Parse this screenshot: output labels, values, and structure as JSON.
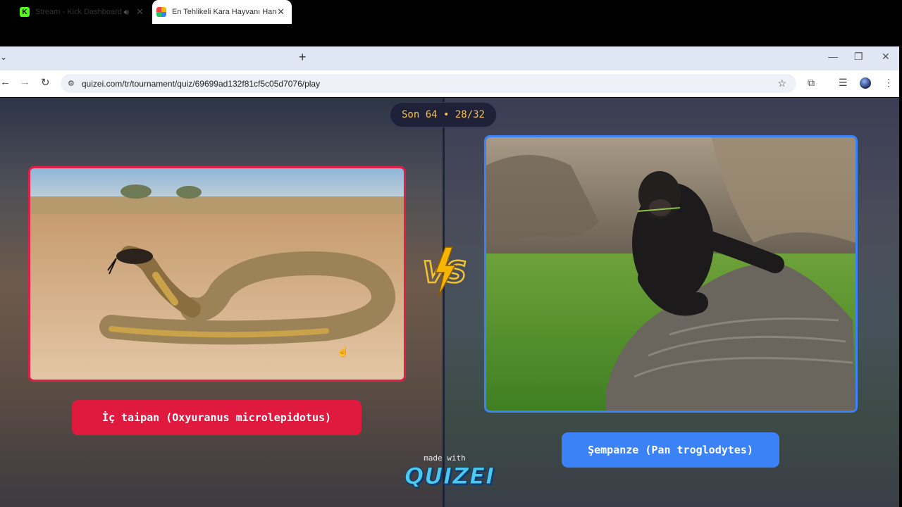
{
  "browser": {
    "tabs": [
      {
        "label": "Stream - Kick Dashboard",
        "favicon": "kick-icon"
      },
      {
        "label": "En Tehlikeli Kara Hayvanı Hangi",
        "favicon": "quizei-icon"
      }
    ],
    "new_tab": "+",
    "url": "quizei.com/tr/tournament/quiz/69699ad132f81cf5c05d7076/play"
  },
  "quiz": {
    "round": "Son 64 • 28/32",
    "left": {
      "name": "İç taipan (Oxyuranus microlepidotus)",
      "accent": "#e11d48",
      "image": "inland-taipan-snake-photo"
    },
    "right": {
      "name": "Şempanze (Pan troglodytes)",
      "accent": "#3b82f6",
      "image": "chimpanzee-photo"
    },
    "vs": "VS",
    "footer_caption": "made with",
    "footer_brand": "QUIZEI"
  }
}
